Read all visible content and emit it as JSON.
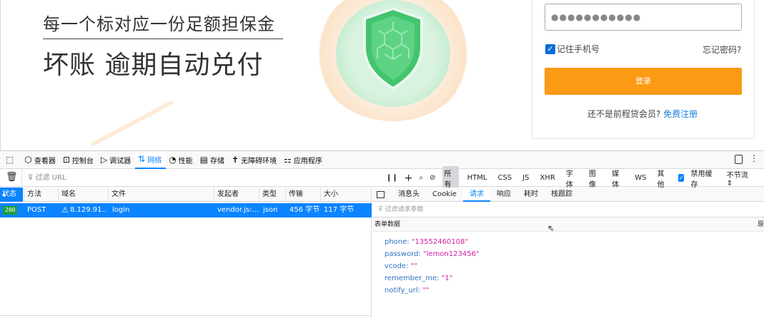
{
  "page": {
    "slogan_line1": "每一个标对应一份足额担保金",
    "slogan_line2": "坏账 逾期自动兑付",
    "password_value": "●●●●●●●●●●●",
    "remember_phone": "记住手机号",
    "forgot_password": "忘记密码?",
    "login_button": "登录",
    "register_prompt": "还不是前程贷会员?",
    "register_link": "免费注册"
  },
  "devtools": {
    "tabs": [
      {
        "icon": "inspector-icon",
        "label": "查看器"
      },
      {
        "icon": "console-icon",
        "label": "控制台"
      },
      {
        "icon": "debugger-icon",
        "label": "调试器"
      },
      {
        "icon": "network-icon",
        "label": "网络",
        "active": true
      },
      {
        "icon": "performance-icon",
        "label": "性能"
      },
      {
        "icon": "storage-icon",
        "label": "存储"
      },
      {
        "icon": "accessibility-icon",
        "label": "无障碍环境"
      },
      {
        "icon": "application-icon",
        "label": "应用程序"
      }
    ],
    "filter_placeholder": "过滤 URL",
    "type_filters": [
      "所有",
      "HTML",
      "CSS",
      "JS",
      "XHR",
      "字体",
      "图像",
      "媒体",
      "WS",
      "其他"
    ],
    "selected_type": "所有",
    "disable_cache": "禁用缓存",
    "throttle": "不节流",
    "columns": [
      "状态",
      "方法",
      "域名",
      "文件",
      "发起者",
      "类型",
      "传输",
      "大小"
    ],
    "request": {
      "status": "200",
      "method": "POST",
      "domain": "8.129.91....",
      "file": "login",
      "initiator": "vendor.js:...",
      "type": "json",
      "transferred": "456 字节",
      "size": "117 字节"
    },
    "detail_tabs": [
      "消息头",
      "Cookie",
      "请求",
      "响应",
      "耗时",
      "栈跟踪"
    ],
    "active_detail_tab": "请求",
    "params_filter_placeholder": "过滤请求参数",
    "form_data_label": "表单数据",
    "raw_label": "原",
    "params": [
      {
        "key": "phone:",
        "value": "\"13552460108\""
      },
      {
        "key": "password:",
        "value": "\"lemon123456\""
      },
      {
        "key": "vcode:",
        "value": "\"\""
      },
      {
        "key": "remember_me:",
        "value": "\"1\""
      },
      {
        "key": "notify_url:",
        "value": "\"\""
      }
    ]
  },
  "colors": {
    "accent_blue": "#0a84ff",
    "login_orange": "#fb9a13",
    "link_blue": "#1680e0",
    "param_key": "#2f72c7",
    "param_value": "#d01ea2"
  }
}
